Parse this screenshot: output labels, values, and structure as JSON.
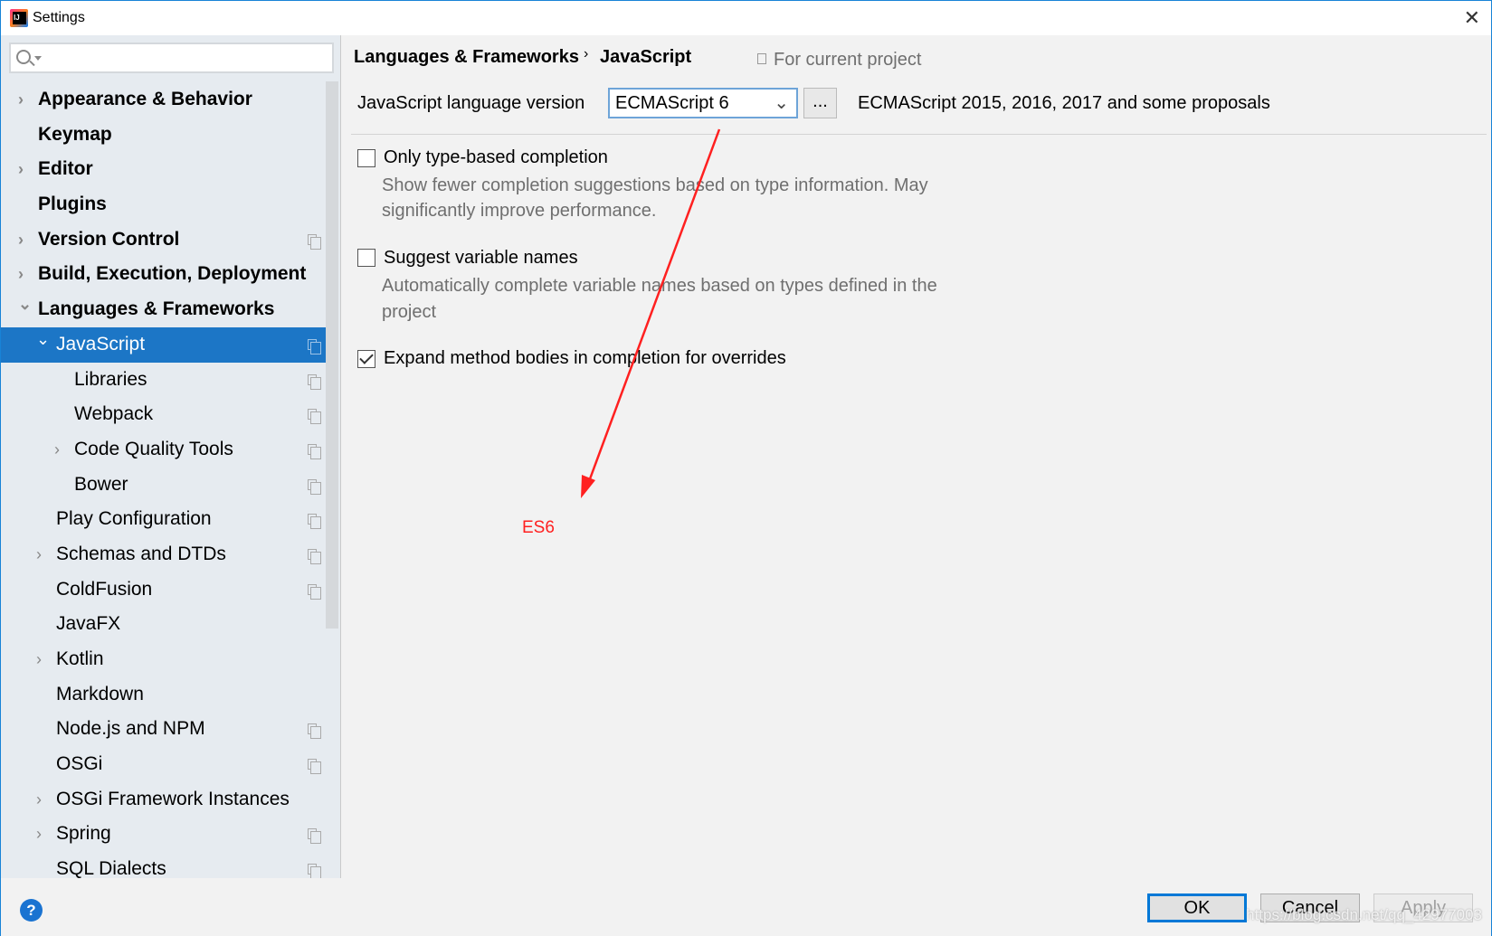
{
  "window": {
    "title": "Settings",
    "close": "✕"
  },
  "sidebar": {
    "search_placeholder": "",
    "items": [
      {
        "label": "Appearance & Behavior",
        "level": 0,
        "bold": true,
        "chevron": "right",
        "project": false
      },
      {
        "label": "Keymap",
        "level": 0,
        "bold": true,
        "chevron": "",
        "project": false
      },
      {
        "label": "Editor",
        "level": 0,
        "bold": true,
        "chevron": "right",
        "project": false
      },
      {
        "label": "Plugins",
        "level": 0,
        "bold": true,
        "chevron": "",
        "project": false
      },
      {
        "label": "Version Control",
        "level": 0,
        "bold": true,
        "chevron": "right",
        "project": true
      },
      {
        "label": "Build, Execution, Deployment",
        "level": 0,
        "bold": true,
        "chevron": "right",
        "project": false
      },
      {
        "label": "Languages & Frameworks",
        "level": 0,
        "bold": true,
        "chevron": "down",
        "project": false
      },
      {
        "label": "JavaScript",
        "level": 1,
        "bold": false,
        "chevron": "down",
        "project": true,
        "selected": true
      },
      {
        "label": "Libraries",
        "level": 2,
        "bold": false,
        "chevron": "",
        "project": true
      },
      {
        "label": "Webpack",
        "level": 2,
        "bold": false,
        "chevron": "",
        "project": true
      },
      {
        "label": "Code Quality Tools",
        "level": 2,
        "bold": false,
        "chevron": "right",
        "project": true
      },
      {
        "label": "Bower",
        "level": 2,
        "bold": false,
        "chevron": "",
        "project": true
      },
      {
        "label": "Play Configuration",
        "level": 1,
        "bold": false,
        "chevron": "",
        "project": true
      },
      {
        "label": "Schemas and DTDs",
        "level": 1,
        "bold": false,
        "chevron": "right",
        "project": true
      },
      {
        "label": "ColdFusion",
        "level": 1,
        "bold": false,
        "chevron": "",
        "project": true
      },
      {
        "label": "JavaFX",
        "level": 1,
        "bold": false,
        "chevron": "",
        "project": false
      },
      {
        "label": "Kotlin",
        "level": 1,
        "bold": false,
        "chevron": "right",
        "project": false
      },
      {
        "label": "Markdown",
        "level": 1,
        "bold": false,
        "chevron": "",
        "project": false
      },
      {
        "label": "Node.js and NPM",
        "level": 1,
        "bold": false,
        "chevron": "",
        "project": true
      },
      {
        "label": "OSGi",
        "level": 1,
        "bold": false,
        "chevron": "",
        "project": true
      },
      {
        "label": "OSGi Framework Instances",
        "level": 1,
        "bold": false,
        "chevron": "right",
        "project": false
      },
      {
        "label": "Spring",
        "level": 1,
        "bold": false,
        "chevron": "right",
        "project": true
      },
      {
        "label": "SQL Dialects",
        "level": 1,
        "bold": false,
        "chevron": "",
        "project": true
      }
    ]
  },
  "main": {
    "breadcrumb": [
      "Languages & Frameworks",
      "JavaScript"
    ],
    "breadcrumb_sep": "›",
    "scope": "For current project",
    "version_label": "JavaScript language version",
    "version_value": "ECMAScript 6",
    "more_button": "...",
    "version_description": "ECMAScript 2015, 2016, 2017 and some proposals",
    "options": [
      {
        "label": "Only type-based completion",
        "checked": false,
        "desc": [
          "Show fewer completion suggestions based on type information. May",
          "significantly improve performance."
        ]
      },
      {
        "label": "Suggest variable names",
        "checked": false,
        "desc": [
          "Automatically complete variable names based on types defined in the",
          "project"
        ]
      },
      {
        "label": "Expand method bodies in completion for overrides",
        "checked": true,
        "desc": []
      }
    ],
    "annotation": {
      "label": "ES6",
      "color": "#ff2020"
    }
  },
  "footer": {
    "help": "?",
    "ok": "OK",
    "cancel": "Cancel",
    "apply": "Apply",
    "watermark": "https://blog.csdn.net/qq_42977003"
  },
  "colors": {
    "accent": "#1c76c6",
    "annotation": "#ff2020"
  }
}
